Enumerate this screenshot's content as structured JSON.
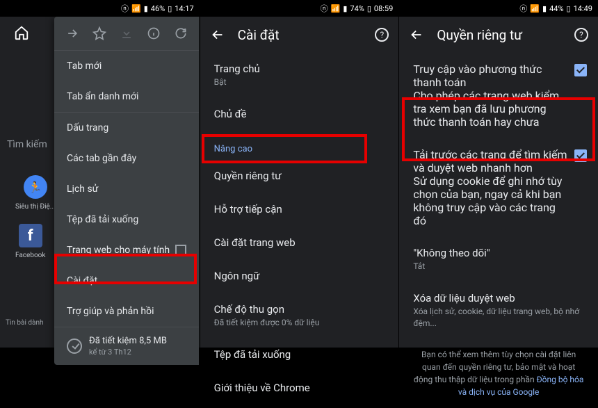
{
  "status": {
    "p1": {
      "battery": "46%",
      "time": "14:17"
    },
    "p2": {
      "battery": "74%",
      "time": "08:59"
    },
    "p3": {
      "battery": "44%",
      "time": "14:49"
    }
  },
  "panel1": {
    "search_hint": "Tìm kiếm",
    "bookmarks": [
      {
        "label": "Siêu thị Điệ..."
      },
      {
        "label": "Facebook"
      }
    ],
    "news_label": "Tin bài dành",
    "menu": {
      "items": [
        "Tab mới",
        "Tab ẩn danh mới",
        "Dấu trang",
        "Các tab gần đây",
        "Lịch sử",
        "Tệp đã tải xuống",
        "Trang web cho máy tính",
        "Cài đặt",
        "Trợ giúp và phản hồi"
      ],
      "saver_title": "Đã tiết kiệm 8,5 MB",
      "saver_sub": "kể từ 3 Th12"
    }
  },
  "panel2": {
    "title": "Cài đặt",
    "items": [
      {
        "title": "Trang chủ",
        "sub": "Bật"
      },
      {
        "title": "Chủ đề",
        "sub": ""
      }
    ],
    "section": "Nâng cao",
    "adv_items": [
      "Quyền riêng tư",
      "Hỗ trợ tiếp cận",
      "Cài đặt trang web",
      "Ngôn ngữ"
    ],
    "compact": {
      "title": "Chế độ thu gọn",
      "sub": "Đã tiết kiệm được 0% dữ liệu"
    },
    "more": [
      "Tệp đã tải xuống",
      "Giới thiệu về Chrome"
    ]
  },
  "panel3": {
    "title": "Quyền riêng tư",
    "items": [
      {
        "title": "Truy cập vào phương thức thanh toán",
        "sub": "Cho phép các trang web kiểm tra xem bạn đã lưu phương thức thanh toán hay chưa",
        "checked": true
      },
      {
        "title": "Tải trước các trang để tìm kiếm và duyệt web nhanh hơn",
        "sub": "Sử dụng cookie để ghi nhớ tùy chọn của bạn, ngay cả khi bạn không truy cập vào các trang đó",
        "checked": true
      },
      {
        "title": "\"Không theo dõi\"",
        "sub": "Tắt"
      },
      {
        "title": "Xóa dữ liệu duyệt web",
        "sub": "Xóa lịch sử, cookie, dữ liệu trang web, bộ nhớ đệm..."
      }
    ],
    "note_pre": "Bạn có thể xem thêm tùy chọn cài đặt liên quan đến quyền riêng tư, bảo mật và hoạt động thu thập dữ liệu trong phần ",
    "note_link": "Đồng bộ hóa và dịch vụ của Google"
  }
}
